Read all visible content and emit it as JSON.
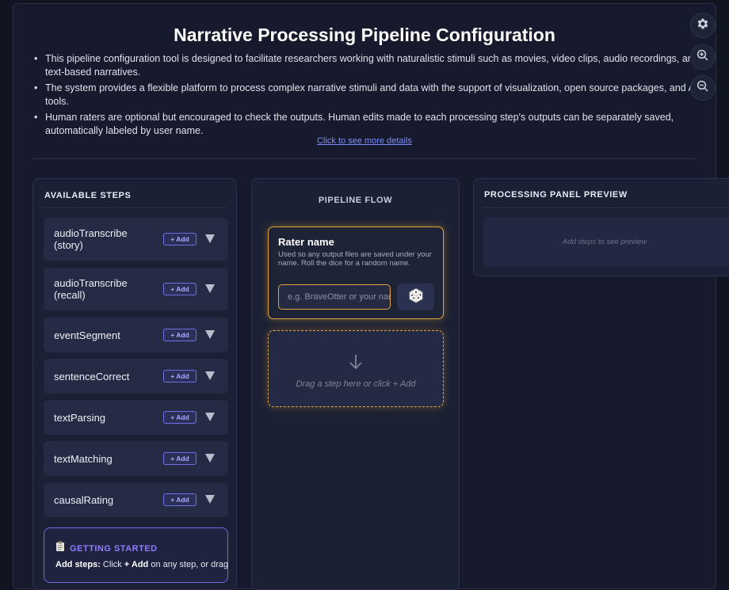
{
  "header": {
    "title": "Narrative Processing Pipeline Configuration",
    "bullets": [
      "This pipeline configuration tool is designed to facilitate researchers working with naturalistic stimuli such as movies, video clips, audio recordings, and text-based narratives.",
      "The system provides a flexible platform to process complex narrative stimuli and data with the support of visualization, open source packages, and AI-tools.",
      "Human raters are optional but encouraged to check the outputs. Human edits made to each processing step's outputs can be separately saved, automatically labeled by user name."
    ],
    "details_link": "Click to see more details"
  },
  "controls": {
    "settings_icon": "gear-icon",
    "zoom_in_icon": "zoom-in-icon",
    "zoom_out_icon": "zoom-out-icon"
  },
  "steps_panel": {
    "title": "AVAILABLE STEPS",
    "add_label": "+ Add",
    "items": [
      {
        "label": "audioTranscribe (story)"
      },
      {
        "label": "audioTranscribe (recall)"
      },
      {
        "label": "eventSegment"
      },
      {
        "label": "sentenceCorrect"
      },
      {
        "label": "textParsing"
      },
      {
        "label": "textMatching"
      },
      {
        "label": "causalRating"
      }
    ],
    "getting_started": {
      "icon": "clipboard-icon",
      "title": "GETTING STARTED",
      "text_bold1": "Add steps:",
      "text1": " Click ",
      "text_bold2": "+ Add",
      "text2": " on any step, or drag"
    }
  },
  "flow_panel": {
    "title": "PIPELINE FLOW",
    "rater": {
      "title": "Rater name",
      "help": "Used so any output files are saved under your name. Roll the dice for a random name.",
      "placeholder": "e.g. BraveOtter or your name",
      "dice_icon": "dice-icon"
    },
    "drop_zone": {
      "text": "Drag a step here or click + Add",
      "icon": "arrow-down-icon"
    }
  },
  "preview_panel": {
    "title": "PROCESSING PANEL PREVIEW",
    "empty_text": "Add steps to see preview"
  },
  "colors": {
    "background": "#111421",
    "panel": "#1b2034",
    "accent": "#6d72e8",
    "highlight": "#e0a33b"
  }
}
